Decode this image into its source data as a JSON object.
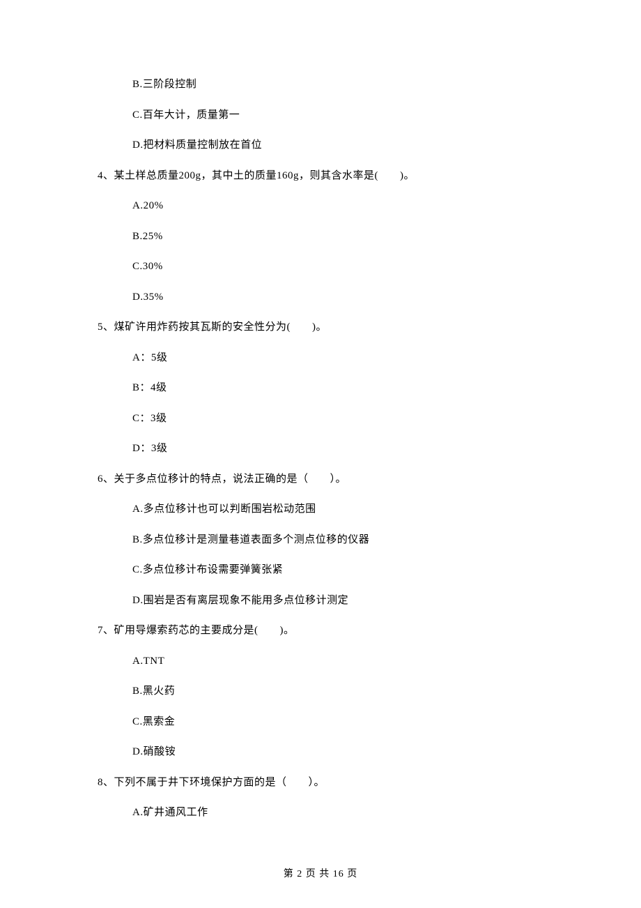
{
  "partial_q3": {
    "b": "B.三阶段控制",
    "c": "C.百年大计，质量第一",
    "d": "D.把材料质量控制放在首位"
  },
  "q4": {
    "stem": "4、某土样总质量200g，其中土的质量160g，则其含水率是(　　)。",
    "a": "A.20%",
    "b": "B.25%",
    "c": "C.30%",
    "d": "D.35%"
  },
  "q5": {
    "stem": "5、煤矿许用炸药按其瓦斯的安全性分为(　　)。",
    "a": "A：5级",
    "b": "B：4级",
    "c": "C：3级",
    "d": "D：3级"
  },
  "q6": {
    "stem": "6、关于多点位移计的特点，说法正确的是（　　）。",
    "a": "A.多点位移计也可以判断围岩松动范围",
    "b": "B.多点位移计是测量巷道表面多个测点位移的仪器",
    "c": "C.多点位移计布设需要弹簧张紧",
    "d": "D.围岩是否有离层现象不能用多点位移计测定"
  },
  "q7": {
    "stem": "7、矿用导爆索药芯的主要成分是(　　)。",
    "a": "A.TNT",
    "b": "B.黑火药",
    "c": "C.黑索金",
    "d": "D.硝酸铵"
  },
  "q8": {
    "stem": "8、下列不属于井下环境保护方面的是（　　）。",
    "a": "A.矿井通风工作"
  },
  "footer": "第 2 页 共 16 页"
}
